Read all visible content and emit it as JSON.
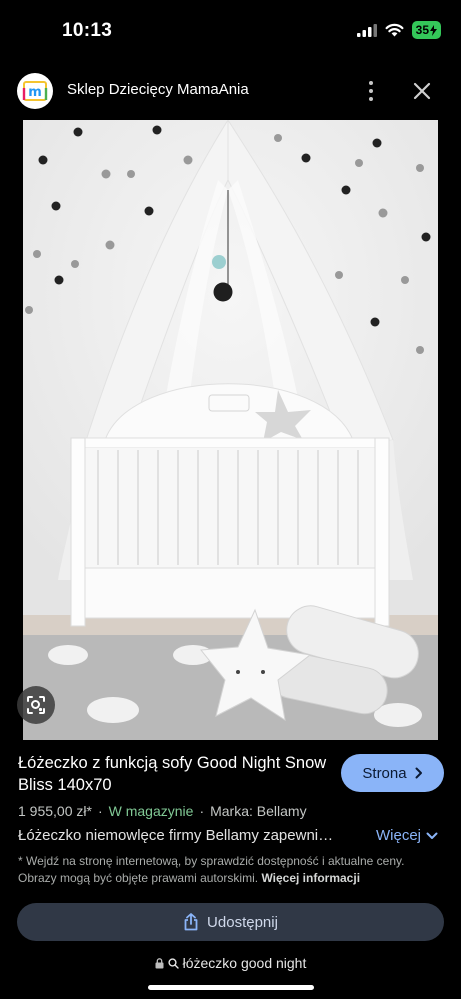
{
  "status": {
    "time": "10:13",
    "battery": "35"
  },
  "header": {
    "site_name": "Sklep Dziecięcy MamaAnia",
    "logo_letter": "m"
  },
  "product": {
    "title": "Łóżeczko z funkcją sofy Good Night Snow Bliss 140x70",
    "visit_label": "Strona",
    "price": "1 955,00 zł*",
    "separator": "·",
    "availability": "W magazynie",
    "brand": "Marka: Bellamy",
    "description": "Łóżeczko niemowlęce firmy Bellamy zapewni…",
    "more_label": "Więcej",
    "disclaimer": "* Wejdź na stronę internetową, by sprawdzić dostępność i aktualne ceny. Obrazy mogą być objęte prawami autorskimi.",
    "disclaimer_link": "Więcej informacji"
  },
  "share": {
    "label": "Udostępnij"
  },
  "url_bar": {
    "query": "łóżeczko good night"
  },
  "colors": {
    "accent": "#8ab4f8",
    "instock": "#81c995",
    "battery": "#34c759"
  },
  "icons": [
    "signal-icon",
    "wifi-icon",
    "battery-icon",
    "more-vert-icon",
    "close-icon",
    "lens-icon",
    "chevron-right-icon",
    "chevron-down-icon",
    "share-icon",
    "lock-icon",
    "search-icon"
  ]
}
